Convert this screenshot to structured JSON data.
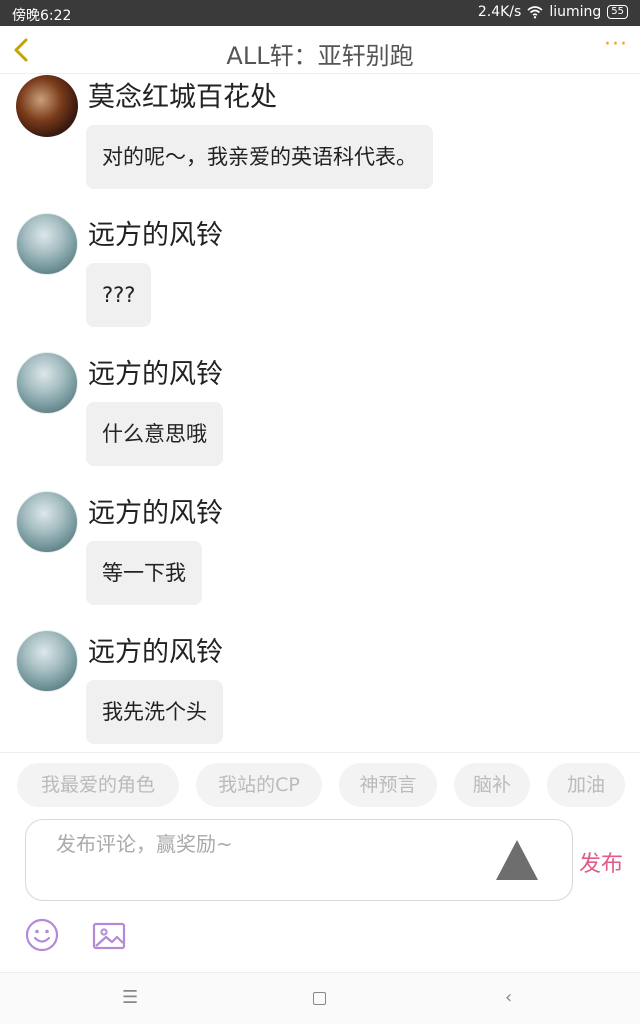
{
  "status_bar": {
    "time": "傍晚6:22",
    "speed": "2.4K/s",
    "network": "liuming",
    "battery": "55"
  },
  "header": {
    "title": "ALL轩：亚轩别跑",
    "more": "···"
  },
  "messages": [
    {
      "user": "莫念红城百花处",
      "text": "对的呢～，我亲爱的英语科代表。",
      "avatar": "red"
    },
    {
      "user": "远方的风铃",
      "text": "???",
      "avatar": "blue"
    },
    {
      "user": "远方的风铃",
      "text": "什么意思哦",
      "avatar": "blue"
    },
    {
      "user": "远方的风铃",
      "text": "等一下我",
      "avatar": "blue"
    },
    {
      "user": "远方的风铃",
      "text": "我先洗个头",
      "avatar": "blue"
    }
  ],
  "tags": [
    "我最爱的角色",
    "我站的CP",
    "神预言",
    "脑补",
    "加油"
  ],
  "comment": {
    "placeholder": "发布评论，赢奖励~",
    "publish": "发布"
  },
  "navbar": {
    "menu": "☰",
    "back": "‹"
  },
  "colors": {
    "accent": "#f0a030",
    "publish": "#e05b8c",
    "icon_purple": "#b38ad6"
  }
}
